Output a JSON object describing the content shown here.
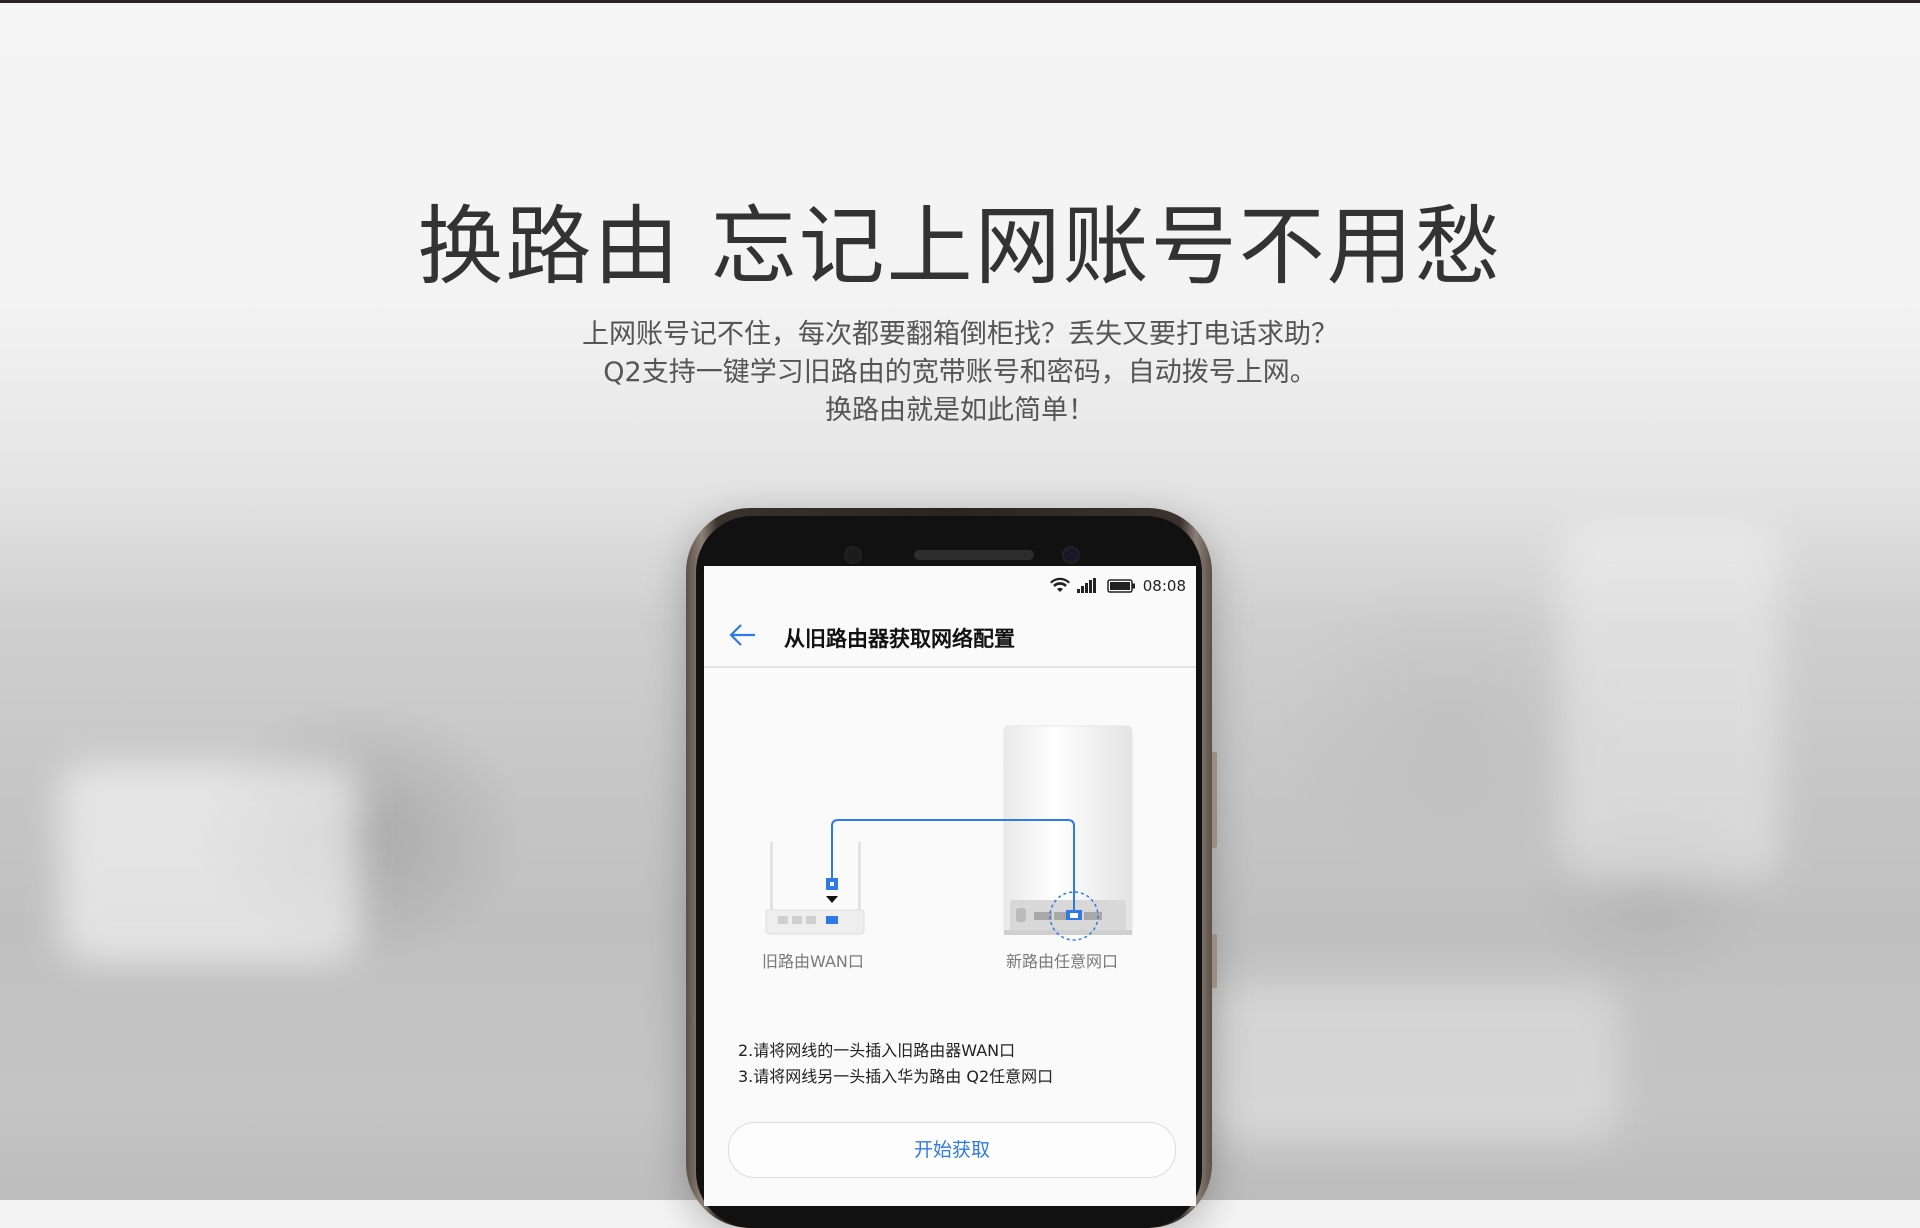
{
  "hero": {
    "title": "换路由 忘记上网账号不用愁",
    "desc_lines": [
      "上网账号记不住，每次都要翻箱倒柜找？丢失又要打电话求助？",
      "Q2支持一键学习旧路由的宽带账号和密码，自动拨号上网。",
      "换路由就是如此简单！"
    ]
  },
  "phone": {
    "status_time": "08:08",
    "status_icons": [
      "wifi-icon",
      "signal-icon",
      "battery-icon"
    ],
    "app_title": "从旧路由器获取网络配置",
    "diagram": {
      "old_router_label": "旧路由WAN口",
      "new_router_label": "新路由任意网口"
    },
    "steps": [
      "2.请将网线的一头插入旧路由器WAN口",
      "3.请将网线另一头插入华为路由 Q2任意网口"
    ],
    "start_button": "开始获取"
  },
  "colors": {
    "accent": "#2f7ae5",
    "headline": "#333333",
    "desc": "#555555"
  }
}
